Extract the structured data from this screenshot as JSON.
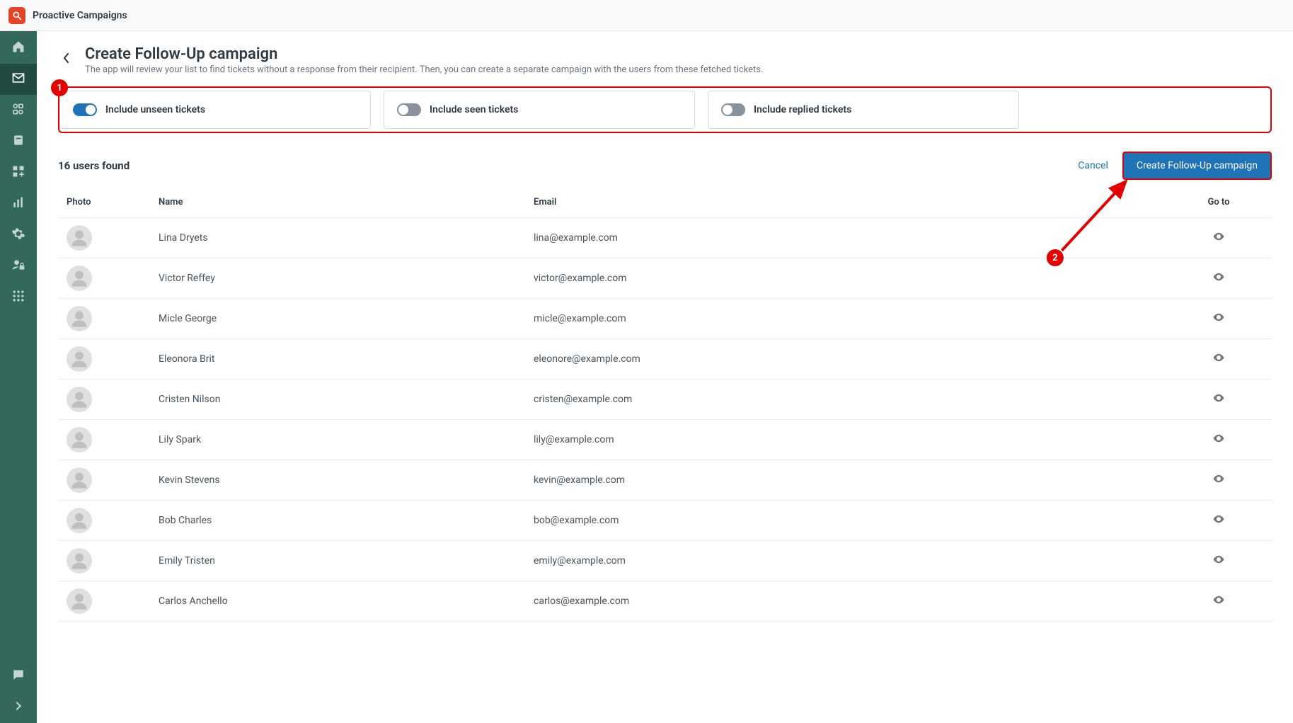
{
  "header": {
    "app_name": "Proactive Campaigns"
  },
  "sidebar": {
    "items": [
      {
        "name": "home-icon"
      },
      {
        "name": "mail-icon",
        "active": true
      },
      {
        "name": "shapes-icon"
      },
      {
        "name": "book-icon"
      },
      {
        "name": "apps-icon"
      },
      {
        "name": "bars-icon"
      },
      {
        "name": "gear-icon"
      },
      {
        "name": "user-lock-icon"
      },
      {
        "name": "grid-icon"
      }
    ],
    "bottom_items": [
      {
        "name": "chat-icon"
      },
      {
        "name": "chevron-right-icon"
      }
    ]
  },
  "main": {
    "title": "Create Follow-Up campaign",
    "subtitle": "The app will review your list to find tickets without a response from their recipient. Then, you can create a separate campaign with the users from these fetched tickets.",
    "toggles": [
      {
        "label": "Include unseen tickets",
        "on": true
      },
      {
        "label": "Include seen tickets",
        "on": false
      },
      {
        "label": "Include replied tickets",
        "on": false
      }
    ],
    "results_count": "16 users found",
    "cancel_label": "Cancel",
    "create_label": "Create Follow-Up campaign",
    "columns": {
      "photo": "Photo",
      "name": "Name",
      "email": "Email",
      "goto": "Go to"
    },
    "users": [
      {
        "name": "Lina Dryets",
        "email": "lina@example.com"
      },
      {
        "name": "Victor Reffey",
        "email": "victor@example.com"
      },
      {
        "name": "Micle George",
        "email": "micle@example.com"
      },
      {
        "name": "Eleonora Brit",
        "email": "eleonore@example.com"
      },
      {
        "name": "Cristen Nilson",
        "email": "cristen@example.com"
      },
      {
        "name": "Lily Spark",
        "email": "lily@example.com"
      },
      {
        "name": "Kevin Stevens",
        "email": "kevin@example.com"
      },
      {
        "name": "Bob Charles",
        "email": "bob@example.com"
      },
      {
        "name": "Emily Tristen",
        "email": "emily@example.com"
      },
      {
        "name": "Carlos Anchello",
        "email": "carlos@example.com"
      }
    ],
    "callouts": {
      "one": "1",
      "two": "2"
    }
  }
}
